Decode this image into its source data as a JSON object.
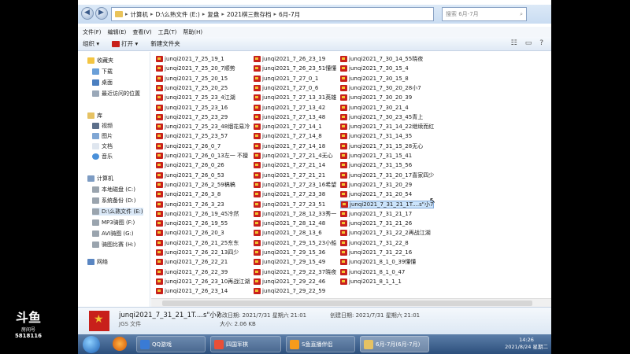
{
  "address_bar": {
    "crumbs": [
      "计算机",
      "D:\\么熟文件 (E:)",
      "复盘",
      "2021棋三数存档",
      "6月-7月"
    ],
    "search_placeholder": "搜索 6月-7月"
  },
  "menu": [
    "文件(F)",
    "编辑(E)",
    "查看(V)",
    "工具(T)",
    "帮助(H)"
  ],
  "toolbar": {
    "organize": "组织 ▾",
    "open": "打开 ▾",
    "new_folder": "新建文件夹"
  },
  "nav": {
    "favorites": "收藏夹",
    "fav_items": [
      "下载",
      "桌面",
      "最近访问的位置"
    ],
    "libraries": "库",
    "lib_items": [
      "视频",
      "图片",
      "文档",
      "音乐"
    ],
    "computer": "计算机",
    "drives": [
      "本地磁盘 (C:)",
      "系统备份 (D:)",
      "D:\\么熟文件 (E:)",
      "MP3骑图 (F:)",
      "AVI骑图 (G:)",
      "骑图比赛 (H:)"
    ],
    "network": "网络"
  },
  "files": {
    "col1": [
      "junqi2021_7_25_19_1",
      "junqi2021_7_25_20_7顺势",
      "junqi2021_7_25_20_15",
      "junqi2021_7_25_20_25",
      "junqi2021_7_25_23_4江湖",
      "junqi2021_7_25_23_16",
      "junqi2021_7_25_23_29",
      "junqi2021_7_25_23_48烟花易冷",
      "junqi2021_7_25_23_57",
      "junqi2021_7_26_0_7",
      "junqi2021_7_26_0_13左一 不擅",
      "junqi2021_7_26_0_26",
      "junqi2021_7_26_0_53",
      "junqi2021_7_26_2_59稿稿",
      "junqi2021_7_26_3_8",
      "junqi2021_7_26_3_23",
      "junqi2021_7_26_19_45冷然",
      "junqi2021_7_26_19_55",
      "junqi2021_7_26_20_3",
      "junqi2021_7_26_21_25东东",
      "junqi2021_7_26_22_13四少",
      "junqi2021_7_26_22_21",
      "junqi2021_7_26_22_39",
      "junqi2021_7_26_23_10再战江湖",
      "junqi2021_7_26_23_14"
    ],
    "col2": [
      "junqi2021_7_26_23_19",
      "junqi2021_7_26_23_51懂懂",
      "junqi2021_7_27_0_1",
      "junqi2021_7_27_0_6",
      "junqi2021_7_27_13_31英雄",
      "junqi2021_7_27_13_42",
      "junqi2021_7_27_13_48",
      "junqi2021_7_27_14_1",
      "junqi2021_7_27_14_8",
      "junqi2021_7_27_14_18",
      "junqi2021_7_27_21_4无心",
      "junqi2021_7_27_21_14",
      "junqi2021_7_27_21_21",
      "junqi2021_7_27_23_16希望",
      "junqi2021_7_27_23_38",
      "junqi2021_7_27_23_51",
      "junqi2021_7_28_12_33秀一",
      "junqi2021_7_28_12_48",
      "junqi2021_7_28_13_6",
      "junqi2021_7_29_15_23小船",
      "junqi2021_7_29_15_36",
      "junqi2021_7_29_15_49",
      "junqi2021_7_29_22_37晓夜",
      "junqi2021_7_29_22_46",
      "junqi2021_7_29_22_59"
    ],
    "col3": [
      "junqi2021_7_30_14_55晓夜",
      "junqi2021_7_30_15_4",
      "junqi2021_7_30_15_8",
      "junqi2021_7_30_20_28小7",
      "junqi2021_7_30_20_39",
      "junqi2021_7_30_21_4",
      "junqi2021_7_30_23_45青上",
      "junqi2021_7_31_14_22继续而红",
      "junqi2021_7_31_14_35",
      "junqi2021_7_31_15_28无心",
      "junqi2021_7_31_15_41",
      "junqi2021_7_31_15_56",
      "junqi2021_7_31_20_17喜家四少",
      "junqi2021_7_31_20_29",
      "junqi2021_7_31_20_54",
      "junqi2021_7_31_21_1T....s\"小7",
      "junqi2021_7_31_21_17",
      "junqi2021_7_31_21_26",
      "junqi2021_7_31_22_2再战江湖",
      "junqi2021_7_31_22_8",
      "junqi2021_7_31_22_16",
      "junqi2021_8_1_0_39懂懂",
      "junqi2021_8_1_0_47",
      "junqi2021_8_1_1_1"
    ]
  },
  "selected_index": 15,
  "details": {
    "name": "junqi2021_7_31_21_1T....s\"小7",
    "modified": "修改日期: 2021/7/31 星期六 21:01",
    "created": "创建日期: 2021/7/31 星期六 21:01",
    "type": "JGS 文件",
    "size": "大小: 2.06 KB"
  },
  "taskbar": {
    "apps": [
      "QQ游戏",
      "四国军棋",
      "S鱼直播伴侣",
      "6月-7月(6月-7月)"
    ],
    "time": "14:26",
    "date": "2021/8/24 星期二"
  },
  "overlay": {
    "logo": "斗鱼",
    "logo_sub": "房间号",
    "room": "5818116"
  }
}
